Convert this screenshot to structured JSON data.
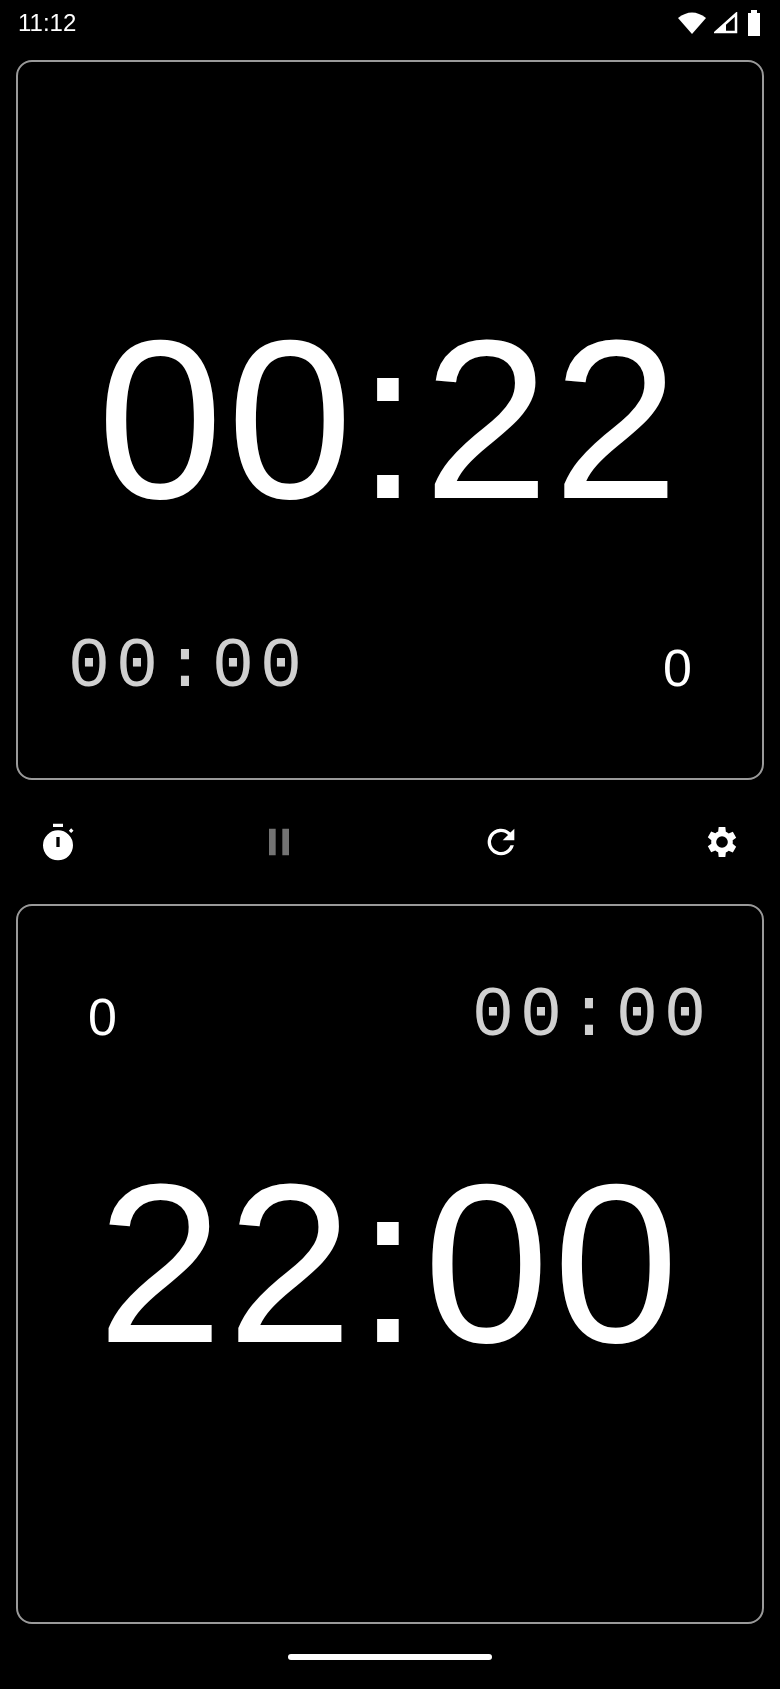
{
  "status_bar": {
    "time": "11:12"
  },
  "players": [
    {
      "kind": "flipped",
      "time": "00:22",
      "move_time": "00:00",
      "moves": "0"
    },
    {
      "kind": "upright",
      "time": "22:00",
      "move_time": "00:00",
      "moves": "0"
    }
  ],
  "toolbar": [
    {
      "kind": "stopwatch",
      "disabled": false
    },
    {
      "kind": "pause",
      "disabled": true
    },
    {
      "kind": "reset",
      "disabled": false
    },
    {
      "kind": "settings",
      "disabled": false
    }
  ]
}
